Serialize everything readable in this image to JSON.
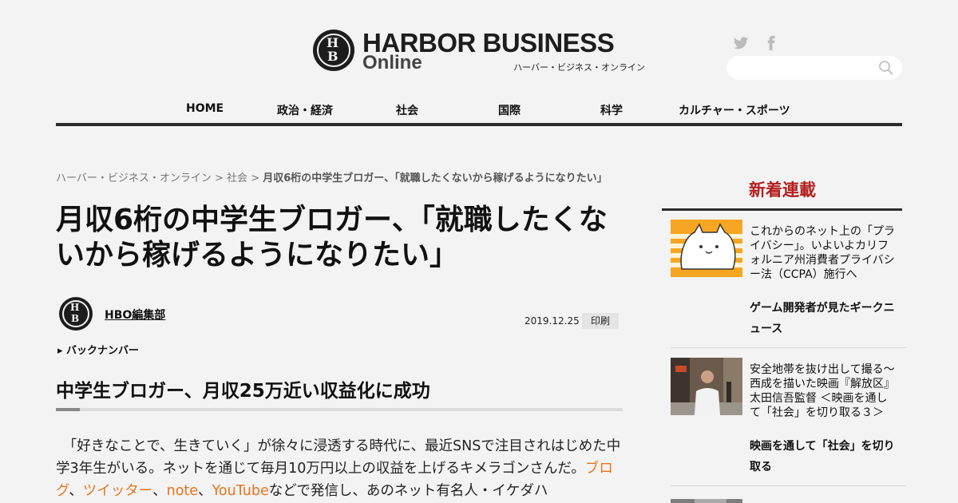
{
  "header": {
    "logo_letter_top": "H",
    "logo_letter_bottom": "B",
    "logo_main": "HARBOR BUSINESS",
    "logo_sub": "Online",
    "logo_kana": "ハーバー・ビジネス・オンライン",
    "social_icons": [
      "twitter-icon",
      "facebook-icon"
    ],
    "search_placeholder": ""
  },
  "nav": {
    "items": [
      "HOME",
      "政治・経済",
      "社会",
      "国際",
      "科学",
      "カルチャー・スポーツ"
    ]
  },
  "breadcrumb": {
    "home": "ハーバー・ビジネス・オンライン",
    "sep": " > ",
    "category": "社会",
    "current": "月収6桁の中学生ブロガー、「就職したくないから稼げるようになりたい」"
  },
  "article": {
    "title": "月収6桁の中学生ブロガー、「就職したくないから稼げるようになりたい」",
    "author": "HBO編集部",
    "date": "2019.12.25",
    "print_label": "印刷",
    "backnumber_label": "▸ バックナンバー",
    "subheading": "中学生ブロガー、月収25万近い収益化に成功",
    "body_intro": "　「好きなことで、生きていく」が徐々に浸透する時代に、最近SNSで注目されはじめた中学3年生がいる。ネットを通じて毎月10万円以上の収益を上げるキメラゴンさんだ。",
    "link_blog": "ブログ",
    "sep_1": "、",
    "link_twitter": "ツイッター",
    "sep_2": "、",
    "link_note": "note",
    "sep_3": "、",
    "link_youtube": "YouTube",
    "body_tail": "などで発信し、あのネット有名人・イケダハ"
  },
  "sidebar": {
    "title": "新着連載",
    "items": [
      {
        "headline": "これからのネット上の「プライバシー」。いよいよカリフォルニア州消費者プライバシー法（CCPA）施行へ",
        "series": "ゲーム開発者が見たギークニュース"
      },
      {
        "headline": "安全地帯を抜け出して撮る～西成を描いた映画『解放区』太田信吾監督 ＜映画を通して「社会」を切り取る３＞",
        "series": "映画を通して「社会」を切り取る"
      }
    ]
  },
  "colors": {
    "accent_red": "#b41f1f",
    "link_orange": "#e8741c",
    "nav_border": "#2b2b2b",
    "background": "#f3f3f3"
  }
}
